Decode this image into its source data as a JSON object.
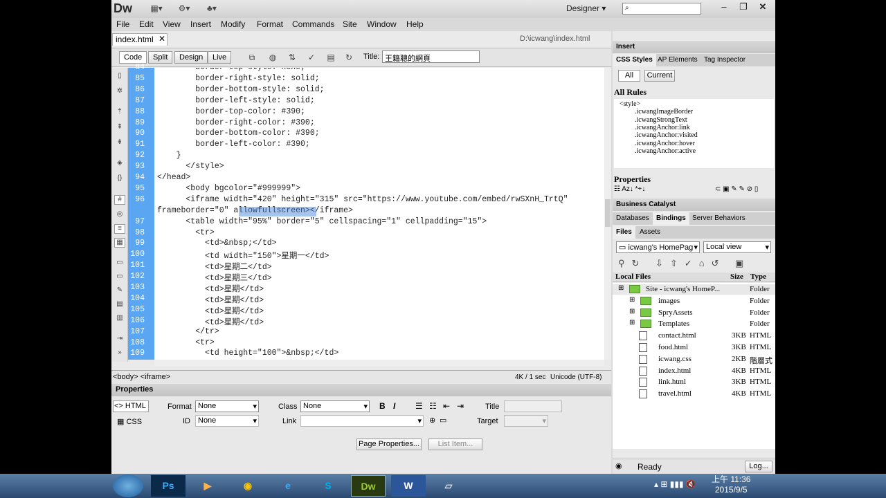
{
  "app": {
    "logo": "Dw",
    "workspace": "Designer"
  },
  "menu": [
    "File",
    "Edit",
    "View",
    "Insert",
    "Modify",
    "Format",
    "Commands",
    "Site",
    "Window",
    "Help"
  ],
  "doc": {
    "tab": "index.html",
    "path": "D:\\icwang\\index.html",
    "views": [
      "Code",
      "Split",
      "Design",
      "Live"
    ],
    "title_label": "Title:",
    "title_value": "王籍聰的網頁"
  },
  "code_lines": [
    {
      "n": "84",
      "t": "        border-top-style: none;"
    },
    {
      "n": "85",
      "t": "        border-right-style: solid;"
    },
    {
      "n": "86",
      "t": "        border-bottom-style: solid;"
    },
    {
      "n": "87",
      "t": "        border-left-style: solid;"
    },
    {
      "n": "88",
      "t": "        border-top-color: #390;"
    },
    {
      "n": "89",
      "t": "        border-right-color: #390;"
    },
    {
      "n": "90",
      "t": "        border-bottom-color: #390;"
    },
    {
      "n": "91",
      "t": "        border-left-color: #390;"
    },
    {
      "n": "92",
      "t": "    }"
    },
    {
      "n": "93",
      "t": "      </style>"
    },
    {
      "n": "94",
      "t": "</head>"
    },
    {
      "n": "95",
      "t": "      <body bgcolor=\"#999999\">"
    },
    {
      "n": "96",
      "t": "      <iframe width=\"420\" height=\"315\" src=\"https://www.youtube.com/embed/rwSXnH_TrtQ\""
    },
    {
      "n": "",
      "t": "frameborder=\"0\" allowfullscreen></iframe>"
    },
    {
      "n": "97",
      "t": "      <table width=\"95%\" border=\"5\" cellspacing=\"1\" cellpadding=\"15\">"
    },
    {
      "n": "98",
      "t": "        <tr>"
    },
    {
      "n": "99",
      "t": "          <td>&nbsp;</td>"
    },
    {
      "n": "100",
      "t": "          <td width=\"150\">星期一</td>"
    },
    {
      "n": "101",
      "t": "          <td>星期二</td>"
    },
    {
      "n": "102",
      "t": "          <td>星期三</td>"
    },
    {
      "n": "103",
      "t": "          <td>星期</td>"
    },
    {
      "n": "104",
      "t": "          <td>星期</td>"
    },
    {
      "n": "105",
      "t": "          <td>星期</td>"
    },
    {
      "n": "106",
      "t": "          <td>星期</td>"
    },
    {
      "n": "107",
      "t": "        </tr>"
    },
    {
      "n": "108",
      "t": "        <tr>"
    },
    {
      "n": "109",
      "t": "          <td height=\"100\">&nbsp;</td>"
    }
  ],
  "status": {
    "tags": "<body> <iframe>",
    "size": "4K / 1 sec",
    "encoding": "Unicode (UTF-8)"
  },
  "props": {
    "header": "Properties",
    "html": "HTML",
    "css": "CSS",
    "format_label": "Format",
    "format_val": "None",
    "class_label": "Class",
    "class_val": "None",
    "id_label": "ID",
    "id_val": "None",
    "link_label": "Link",
    "title_label": "Title",
    "target_label": "Target",
    "page_props": "Page Properties...",
    "list_item": "List Item..."
  },
  "right": {
    "insert": "Insert",
    "css_tabs": [
      "CSS Styles",
      "AP Elements",
      "Tag Inspector"
    ],
    "all": "All",
    "current": "Current",
    "all_rules": "All Rules",
    "rules": [
      "<style>",
      ".icwangImageBorder",
      ".icwangStrongText",
      ".icwangAnchor:link",
      ".icwangAnchor:visited",
      ".icwangAnchor:hover",
      ".icwangAnchor:active"
    ],
    "properties": "Properties",
    "bc": "Business Catalyst",
    "db_tabs": [
      "Databases",
      "Bindings",
      "Server Behaviors"
    ],
    "files_tabs": [
      "Files",
      "Assets"
    ],
    "site_sel": "icwang's HomePag",
    "view_sel": "Local view",
    "col_local": "Local Files",
    "col_size": "Size",
    "col_type": "Type",
    "files": [
      {
        "name": "Site - icwang's HomeP...",
        "size": "",
        "type": "Folder",
        "kind": "site"
      },
      {
        "name": "images",
        "size": "",
        "type": "Folder",
        "kind": "folder"
      },
      {
        "name": "SpryAssets",
        "size": "",
        "type": "Folder",
        "kind": "folder"
      },
      {
        "name": "Templates",
        "size": "",
        "type": "Folder",
        "kind": "folder"
      },
      {
        "name": "contact.html",
        "size": "3KB",
        "type": "HTML",
        "kind": "file"
      },
      {
        "name": "food.html",
        "size": "3KB",
        "type": "HTML",
        "kind": "file"
      },
      {
        "name": "icwang.css",
        "size": "2KB",
        "type": "階層式",
        "kind": "file"
      },
      {
        "name": "index.html",
        "size": "4KB",
        "type": "HTML",
        "kind": "file"
      },
      {
        "name": "link.html",
        "size": "3KB",
        "type": "HTML",
        "kind": "file"
      },
      {
        "name": "travel.html",
        "size": "4KB",
        "type": "HTML",
        "kind": "file"
      }
    ],
    "ready": "Ready",
    "log": "Log..."
  },
  "taskbar": {
    "apps": [
      "Ps",
      "Chrome",
      "IE",
      "Skype",
      "Dw",
      "W"
    ],
    "time": "上午 11:36",
    "date": "2015/9/5"
  }
}
